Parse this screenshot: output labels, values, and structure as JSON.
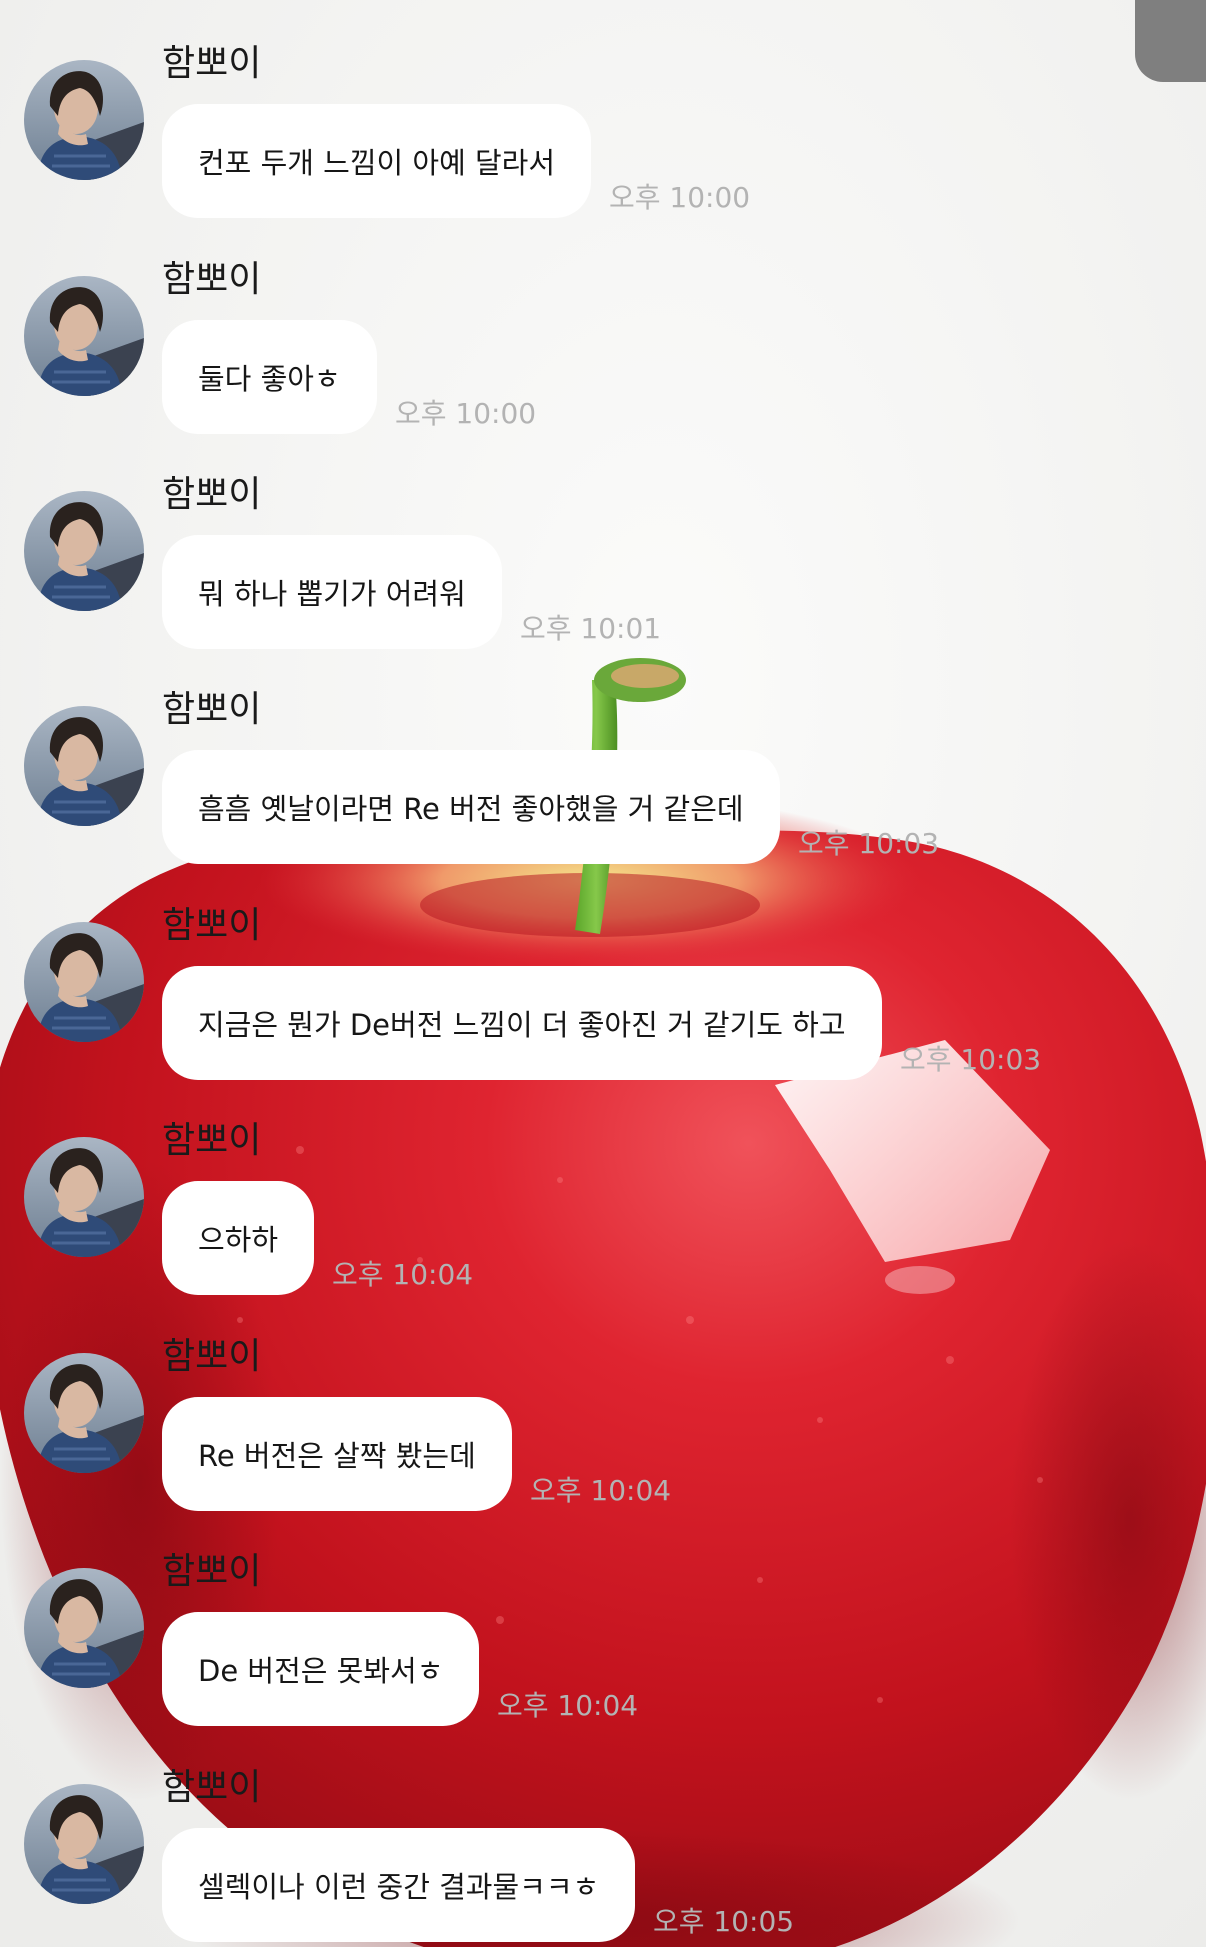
{
  "chat": {
    "messages": [
      {
        "sender": "함뽀이",
        "text": "컨포 두개 느낌이 아예 달라서",
        "time": "오후 10:00"
      },
      {
        "sender": "함뽀이",
        "text": "둘다 좋아ㅎ",
        "time": "오후 10:00"
      },
      {
        "sender": "함뽀이",
        "text": "뭐 하나 뽑기가 어려워",
        "time": "오후 10:01"
      },
      {
        "sender": "함뽀이",
        "text": "흠흠 옛날이라면 Re 버전 좋아했을 거 같은데",
        "time": "오후 10:03"
      },
      {
        "sender": "함뽀이",
        "text": "지금은 뭔가 De버전 느낌이 더 좋아진 거 같기도 하고",
        "time": "오후 10:03"
      },
      {
        "sender": "함뽀이",
        "text": "으하하",
        "time": "오후 10:04"
      },
      {
        "sender": "함뽀이",
        "text": "Re 버전은 살짝 봤는데",
        "time": "오후 10:04"
      },
      {
        "sender": "함뽀이",
        "text": "De 버전은 못봐서ㅎ",
        "time": "오후 10:04"
      },
      {
        "sender": "함뽀이",
        "text": "셀렉이나 이런 중간 결과물ㅋㅋㅎ",
        "time": "오후 10:05"
      }
    ]
  }
}
